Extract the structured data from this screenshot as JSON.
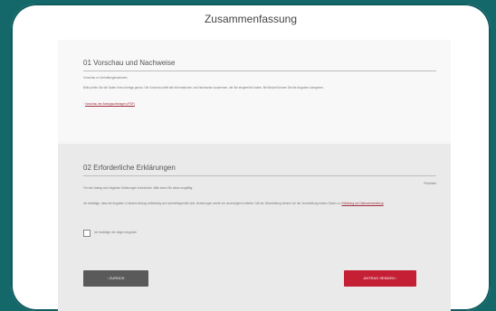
{
  "page_title": "Zusammenfassung",
  "section1": {
    "heading": "01 Vorschau und Nachweise",
    "line1": "Vorschau zu Verhaltungsnachweis",
    "paragraph": "Bitte prüfen Sie die Daten Ihres Antrags genau. Die Vorschau stellt alle Informationen und Nachweise zusammen, die Sie eingereicht haben. Bei Bedarf können Sie die Angaben korrigieren.",
    "link": "Vorschau der Antragsunterlagen (PDF)"
  },
  "section2": {
    "heading": "02 Erforderliche Erklärungen",
    "intro": "Für den Antrag sind folgende Erklärungen erforderlich. Bitte lesen Sie diese sorgfältig.",
    "right_note": "Pflichtfeld",
    "paragraph": "Ich bestätige, dass die Angaben in diesem Antrag vollständig und wahrheitsgemäß sind. Änderungen werde ich unverzüglich mitteilen. Mit der Übermittlung stimme ich der Verarbeitung meiner Daten zu.",
    "link": "Erklärung zur Datenverarbeitung",
    "checkbox_label": "Ich bestätige die obigen Angaben",
    "back_label": "‹ ZURÜCK",
    "next_label": "ANTRAG SENDEN ›"
  },
  "colors": {
    "background": "#15686a",
    "accent": "#c51f35",
    "secondary_button": "#5a5a5a"
  }
}
